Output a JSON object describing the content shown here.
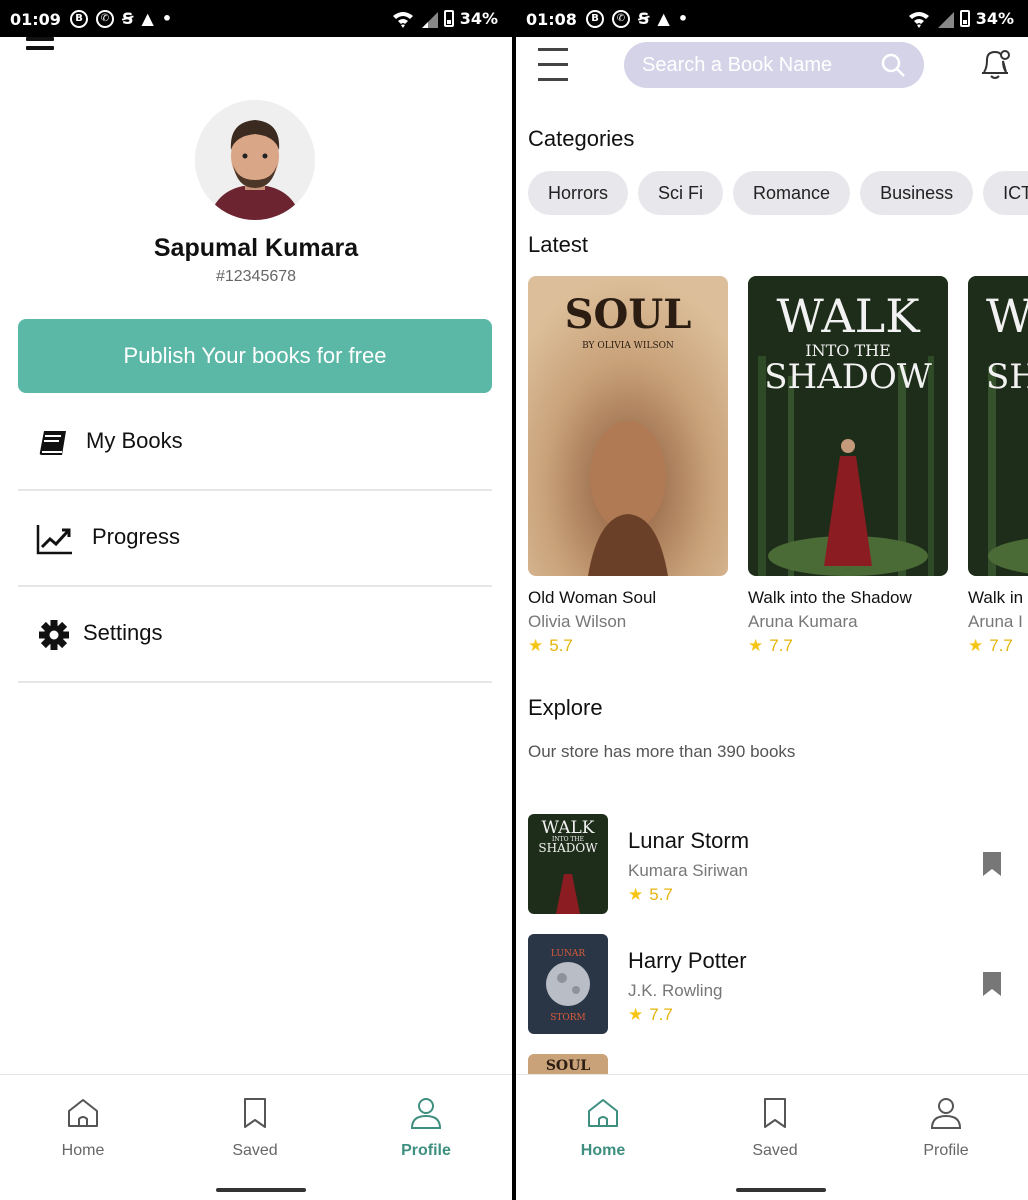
{
  "colors": {
    "accent": "#5bb7a6",
    "nav_active": "#3f8f80",
    "search_bg": "#d5d3e8",
    "rating": "#e5b40c"
  },
  "left_screen": {
    "status_bar": {
      "time": "01:09",
      "battery": "34%"
    },
    "profile": {
      "name": "Sapumal Kumara",
      "id": "#12345678",
      "avatar_icon": "user-avatar-photo"
    },
    "publish_button": "Publish Your books for free",
    "menu": [
      {
        "label": "My Books",
        "icon": "book-icon"
      },
      {
        "label": "Progress",
        "icon": "chart-line-icon"
      },
      {
        "label": "Settings",
        "icon": "gear-icon"
      }
    ],
    "nav": [
      {
        "label": "Home",
        "icon": "home-icon",
        "active": false
      },
      {
        "label": "Saved",
        "icon": "bookmark-icon",
        "active": false
      },
      {
        "label": "Profile",
        "icon": "user-icon",
        "active": true
      }
    ]
  },
  "right_screen": {
    "status_bar": {
      "time": "01:08",
      "battery": "34%"
    },
    "search": {
      "placeholder": "Search a Book Name"
    },
    "categories_title": "Categories",
    "categories": [
      "Horrors",
      "Sci Fi",
      "Romance",
      "Business",
      "ICT"
    ],
    "latest_title": "Latest",
    "latest": [
      {
        "title": "Old Woman Soul",
        "author": "Olivia Wilson",
        "rating": "5.7",
        "cover_title": "SOUL",
        "cover_sub": "BY OLIVIA WILSON"
      },
      {
        "title": "Walk into the Shadow",
        "author": "Aruna Kumara",
        "rating": "7.7",
        "cover_title": "WALK",
        "cover_mid": "INTO THE",
        "cover_end": "SHADOW"
      },
      {
        "title": "Walk in",
        "author": "Aruna I",
        "rating": "7.7",
        "cover_title": "W",
        "cover_end": "SH"
      }
    ],
    "explore_title": "Explore",
    "explore_subtitle": "Our store has more than 390 books",
    "explore_list": [
      {
        "title": "Lunar Storm",
        "author": "Kumara Siriwan",
        "rating": "5.7",
        "thumb_top": "WALK",
        "thumb_mid": "INTO THE",
        "thumb_end": "SHADOW"
      },
      {
        "title": "Harry Potter",
        "author": "J.K. Rowling",
        "rating": "7.7",
        "thumb_top": "LUNAR",
        "thumb_end": "STORM"
      },
      {
        "title": "",
        "author": "",
        "rating": "",
        "thumb_top": "SOUL"
      }
    ],
    "nav": [
      {
        "label": "Home",
        "icon": "home-icon",
        "active": true
      },
      {
        "label": "Saved",
        "icon": "bookmark-icon",
        "active": false
      },
      {
        "label": "Profile",
        "icon": "user-icon",
        "active": false
      }
    ]
  }
}
